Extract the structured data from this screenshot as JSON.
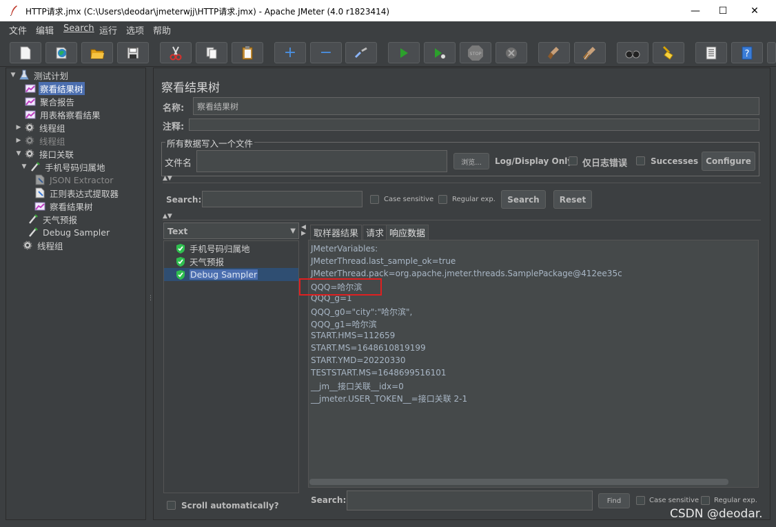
{
  "window": {
    "title": "HTTP请求.jmx (C:\\Users\\deodar\\jmeterwjj\\HTTP请求.jmx) - Apache JMeter (4.0 r1823414)",
    "minimize": "—",
    "maximize": "☐",
    "close": "✕"
  },
  "menu": [
    "文件",
    "编辑",
    "Search",
    "运行",
    "选项",
    "帮助"
  ],
  "toolbar": {
    "icons": [
      "new-icon",
      "templates-icon",
      "open-icon",
      "save-icon",
      "cut-icon",
      "copy-icon",
      "paste-icon",
      "expand-icon",
      "collapse-icon",
      "toggle-icon",
      "start-icon",
      "start-no-pause-icon",
      "stop-icon",
      "shutdown-icon",
      "clear-icon",
      "clear-all-icon",
      "search-icon",
      "reset-search-icon",
      "function-helper-icon",
      "help-icon"
    ],
    "expand_glyph": "+",
    "collapse_glyph": "−",
    "stop_label": "STOP",
    "help_glyph": "?"
  },
  "tree": {
    "items": [
      {
        "label": "测试计划",
        "icon": "test-plan-icon",
        "twisty": "▼"
      },
      {
        "label": "察看结果树",
        "icon": "listener-icon",
        "selected": true
      },
      {
        "label": "聚合报告",
        "icon": "listener-icon"
      },
      {
        "label": "用表格察看结果",
        "icon": "listener-icon"
      },
      {
        "label": "线程组",
        "icon": "thread-group-icon",
        "twisty": "▶"
      },
      {
        "label": "线程组",
        "icon": "thread-group-icon",
        "twisty": "▶",
        "disabled": true
      },
      {
        "label": "接口关联",
        "icon": "thread-group-icon",
        "twisty": "▼"
      },
      {
        "label": "手机号码归属地",
        "icon": "sampler-icon",
        "twisty": "▼"
      },
      {
        "label": "JSON Extractor",
        "icon": "extractor-icon",
        "disabled": true
      },
      {
        "label": "正则表达式提取器",
        "icon": "extractor-icon"
      },
      {
        "label": "察看结果树",
        "icon": "listener-icon"
      },
      {
        "label": "天气预报",
        "icon": "sampler-icon"
      },
      {
        "label": "Debug Sampler",
        "icon": "sampler-icon"
      },
      {
        "label": "线程组",
        "icon": "thread-group-icon"
      }
    ]
  },
  "panel": {
    "title": "察看结果树",
    "name_label": "名称:",
    "name_value": "察看结果树",
    "comment_label": "注释:",
    "file_group_title": "所有数据写入一个文件",
    "filename_label": "文件名",
    "browse_label": "浏览...",
    "log_display_label": "Log/Display Only:",
    "errors_only_label": "仅日志错误",
    "successes_label": "Successes",
    "configure_label": "Configure",
    "search_label": "Search:",
    "case_sensitive_label": "Case sensitive",
    "regex_label": "Regular exp.",
    "search_button": "Search",
    "reset_button": "Reset",
    "renderer_value": "Text",
    "renderer_arrow": "▼",
    "scroll_auto_label": "Scroll automatically?",
    "tabs": [
      "取样器结果",
      "请求",
      "响应数据"
    ],
    "active_tab": 2,
    "results": [
      {
        "label": "手机号码归属地"
      },
      {
        "label": "天气预报"
      },
      {
        "label": "Debug Sampler",
        "selected": true
      }
    ],
    "response_lines": [
      "JMeterVariables:",
      "JMeterThread.last_sample_ok=true",
      "JMeterThread.pack=org.apache.jmeter.threads.SamplePackage@412ee35c",
      "QQQ=哈尔滨",
      "QQQ_g=1",
      "QQQ_g0=\"city\":\"哈尔滨\",",
      "QQQ_g1=哈尔滨",
      "START.HMS=112659",
      "START.MS=1648610819199",
      "START.YMD=20220330",
      "TESTSTART.MS=1648699516101",
      "__jm__接口关联__idx=0",
      "__jmeter.USER_TOKEN__=接口关联 2-1"
    ],
    "bottom_search_label": "Search:",
    "find_button": "Find",
    "bottom_case_label": "Case sensitive",
    "bottom_regex_label": "Regular exp."
  },
  "watermark": "CSDN @deodar.",
  "colors": {
    "background": "#3c3f41",
    "selection": "#4b6eaf",
    "highlight_box": "#e02020",
    "success": "#2fbf4f"
  }
}
